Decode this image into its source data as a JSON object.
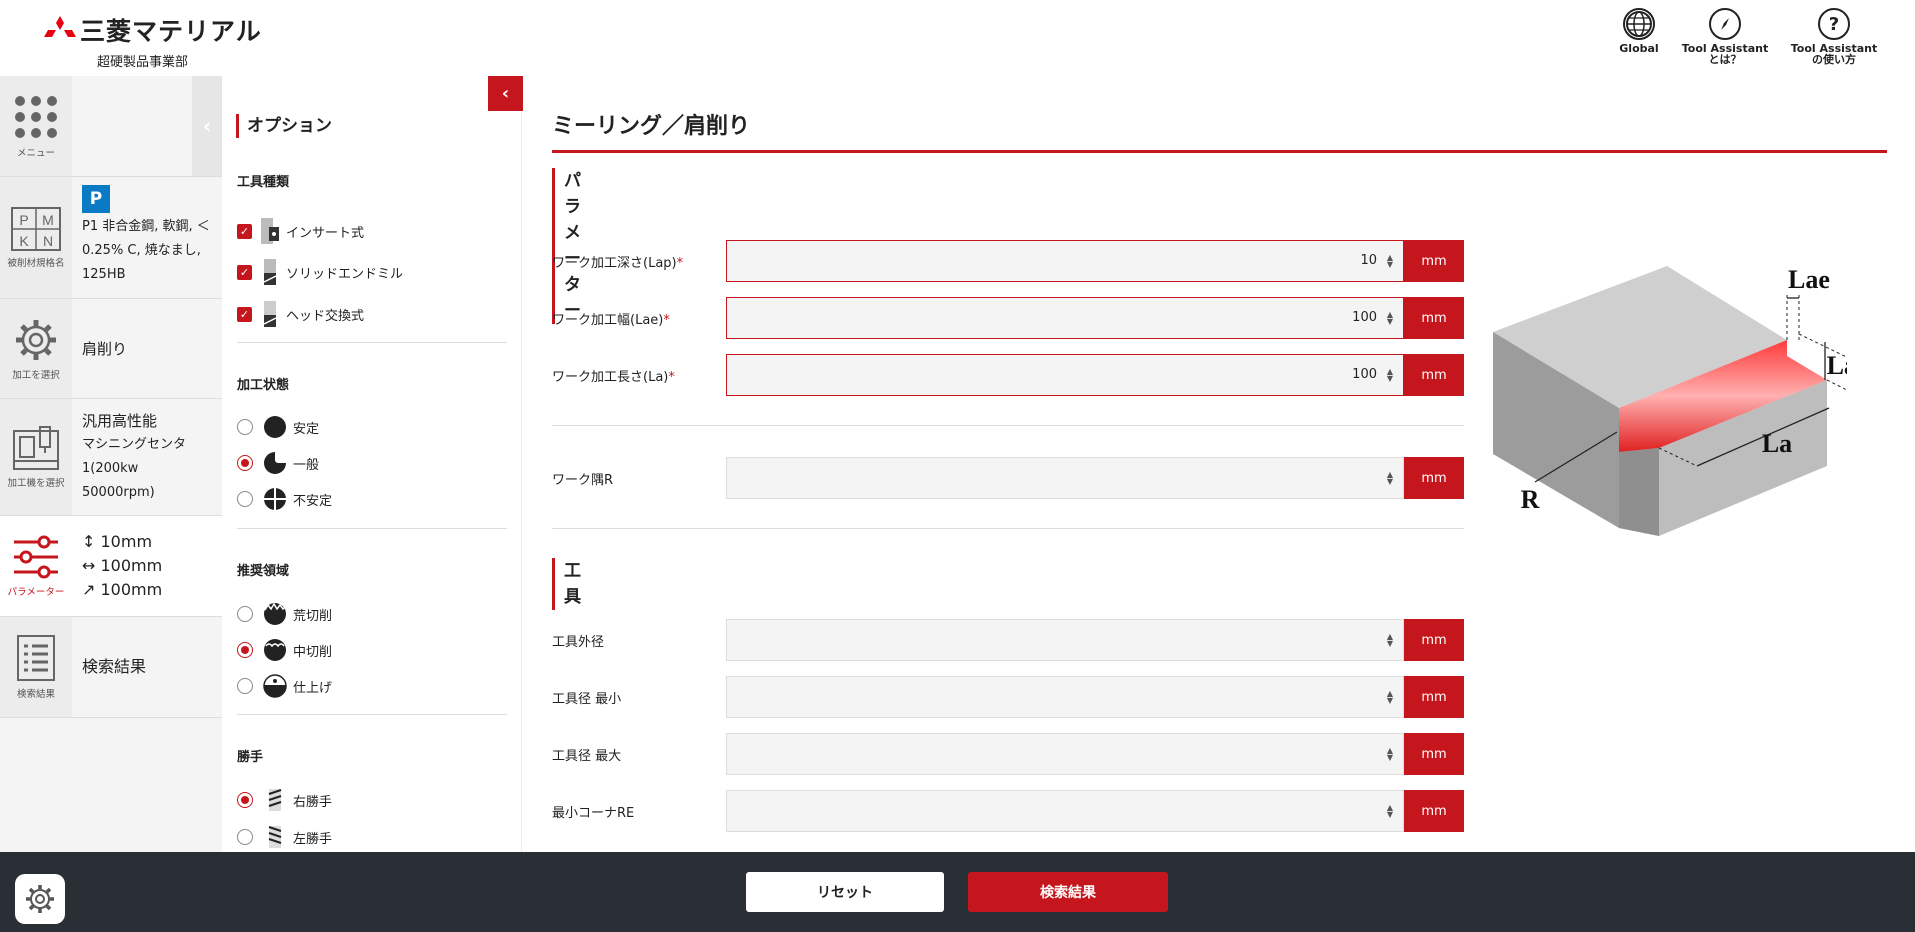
{
  "header": {
    "logo_text": "三菱マテリアル",
    "logo_sub": "超硬製品事業部",
    "icons": [
      {
        "label": "Global",
        "icon": "globe-icon"
      },
      {
        "label": "Tool Assistant とは？",
        "icon": "compass-icon"
      },
      {
        "label": "Tool Assistant の使い方",
        "icon": "question-icon"
      }
    ]
  },
  "nav": {
    "menu_caption": "メニュー",
    "material": {
      "caption": "被削材規格名",
      "badge": "P",
      "text": "P1 非合金鋼, 軟鋼, ＜0.25% C, 焼なまし, 125HB"
    },
    "process": {
      "caption": "加工を選択",
      "text": "肩削り"
    },
    "machine": {
      "caption": "加工機を選択",
      "line1": "汎用高性能",
      "line2": "マシニングセンタ",
      "line3": "1(200kw",
      "line4": "50000rpm)"
    },
    "params": {
      "caption": "パラメーター",
      "depth": "↕ 10mm",
      "width": "↔ 100mm",
      "length": "↗ 100mm"
    },
    "results": {
      "caption": "検索結果",
      "text": "検索結果"
    }
  },
  "options": {
    "title": "オプション",
    "tool_type": {
      "heading": "工具種類",
      "items": [
        "インサート式",
        "ソリッドエンドミル",
        "ヘッド交換式"
      ]
    },
    "condition": {
      "heading": "加工状態",
      "items": [
        "安定",
        "一般",
        "不安定"
      ]
    },
    "region": {
      "heading": "推奨領域",
      "items": [
        "荒切削",
        "中切削",
        "仕上げ"
      ]
    },
    "hand": {
      "heading": "勝手",
      "items": [
        "右勝手",
        "左勝手"
      ]
    }
  },
  "main": {
    "title": "ミーリング／肩削り",
    "params_heading": "パラメーター",
    "tool_heading": "工具",
    "unit": "mm",
    "fields": [
      {
        "label": "ワーク加工深さ(Lap)",
        "req": "*",
        "value": "10"
      },
      {
        "label": "ワーク加工幅(Lae)",
        "req": "*",
        "value": "100"
      },
      {
        "label": "ワーク加工長さ(La)",
        "req": "*",
        "value": "100"
      },
      {
        "label": "ワーク隅R",
        "value": ""
      }
    ],
    "tool_fields": [
      {
        "label": "工具外径",
        "value": ""
      },
      {
        "label": "工具径 最小",
        "value": ""
      },
      {
        "label": "工具径 最大",
        "value": ""
      },
      {
        "label": "最小コーナRE",
        "value": ""
      }
    ],
    "diagram": {
      "lae": "Lae",
      "lap": "Lap",
      "la": "La",
      "r": "R"
    }
  },
  "footer": {
    "reset": "リセット",
    "search": "検索結果"
  },
  "colors": {
    "accent": "#c4161c",
    "footer": "#2a2e35"
  }
}
